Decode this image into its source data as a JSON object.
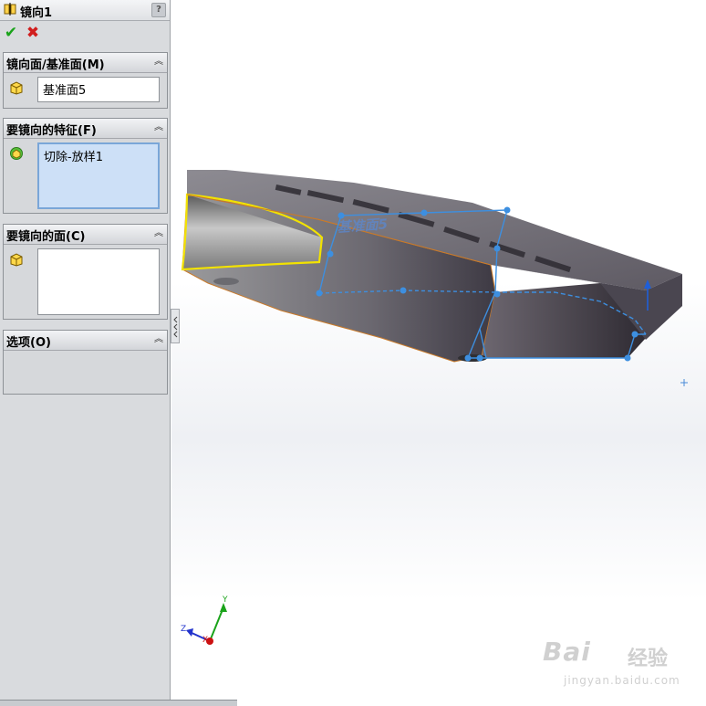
{
  "property_manager": {
    "title": "镜向1",
    "help_label": "?",
    "ok_glyph": "✔",
    "cancel_glyph": "✖",
    "sections": {
      "mirror_plane": {
        "label": "镜向面/基准面(M)",
        "value": "基准面5"
      },
      "features_to_mirror": {
        "label": "要镜向的特征(F)",
        "items": [
          "切除-放样1"
        ]
      },
      "faces_to_mirror": {
        "label": "要镜向的面(C)",
        "items": []
      },
      "options": {
        "label": "选项(O)"
      }
    },
    "collapse_glyph": "︽"
  },
  "viewport": {
    "axis_labels": {
      "x": "X",
      "y": "Y",
      "z": "Z"
    },
    "model_annotation": "基准面5"
  },
  "watermark": {
    "main": "Bai",
    "cn": "经验",
    "url": "jingyan.baidu.com"
  },
  "colors": {
    "panel_bg": "#d9dbde",
    "selection_blue": "#3d8fe0",
    "highlight_yellow": "#f2e200",
    "body_dark": "#4a4650",
    "ok_green": "#1aa31a",
    "cancel_red": "#d11e1e"
  }
}
